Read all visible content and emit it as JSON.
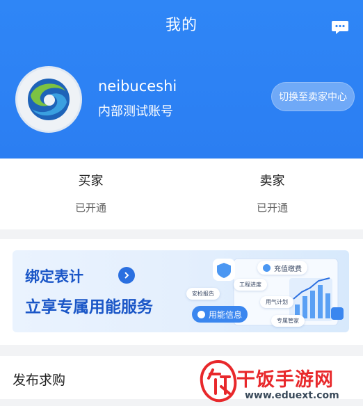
{
  "header": {
    "title": "我的",
    "message_icon": "chat-bubble-icon"
  },
  "profile": {
    "avatar_icon": "swirl-logo-icon",
    "username": "neibuceshi",
    "subtitle": "内部测试账号",
    "switch_label": "切换至卖家中心"
  },
  "roles": [
    {
      "name": "买家",
      "status": "已开通"
    },
    {
      "name": "卖家",
      "status": "已开通"
    }
  ],
  "banner": {
    "line1": "绑定表计",
    "line2": "立享专属用能服务",
    "tags": [
      "充值缴费",
      "工程进度",
      "安检报告",
      "用气计划",
      "用能信息",
      "专属管家"
    ]
  },
  "publish": {
    "label": "发布求购"
  },
  "watermark": {
    "text": "干饭手游网",
    "url": "www.eduext.com",
    "logo_icon": "fan-character-logo-icon"
  },
  "colors": {
    "header": "#2f86f6",
    "banner_text": "#1a56c7",
    "watermark": "#e8282b"
  }
}
